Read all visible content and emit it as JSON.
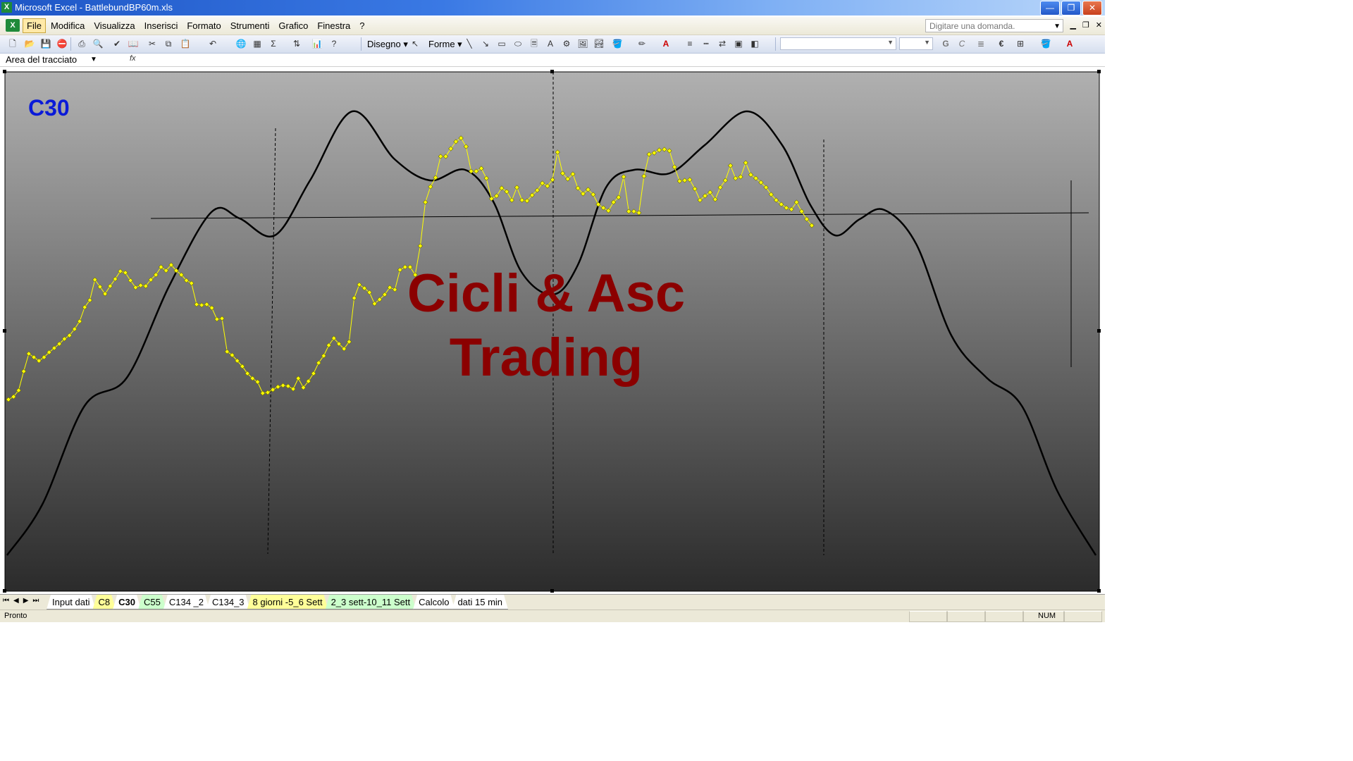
{
  "window": {
    "title": "Microsoft Excel - BattlebundBP60m.xls",
    "controls": [
      "—",
      "❐",
      "✕"
    ]
  },
  "menu": {
    "items": [
      "File",
      "Modifica",
      "Visualizza",
      "Inserisci",
      "Formato",
      "Strumenti",
      "Grafico",
      "Finestra",
      "?"
    ],
    "active": "File",
    "ask_placeholder": "Digitare una domanda."
  },
  "toolbar": {
    "draw_label": "Disegno",
    "shapes_label": "Forme",
    "bold_label": "G",
    "italic_label": "C",
    "euro_label": "€"
  },
  "namebox": {
    "value": "Area del tracciato",
    "fx": "fx"
  },
  "chart": {
    "label": "C30",
    "watermark_line1": "Cicli & Asc",
    "watermark_line2": "Trading",
    "colors": {
      "plot_top": "#b0b0b0",
      "plot_bottom": "#2b2b2b",
      "label": "#0a1ad8",
      "watermark": "#8b0000",
      "price_series": "#ffff00",
      "cycle_curve": "#000000"
    }
  },
  "chart_data": {
    "type": "line",
    "title": "C30",
    "series": [
      {
        "role": "price",
        "color": "#ffff00",
        "marker": "diamond",
        "values": [
          567,
          563,
          554,
          527,
          502,
          507,
          512,
          507,
          500,
          494,
          488,
          481,
          476,
          467,
          456,
          436,
          426,
          397,
          407,
          417,
          406,
          396,
          385,
          387,
          398,
          408,
          405,
          406,
          397,
          390,
          379,
          384,
          376,
          384,
          390,
          398,
          402,
          432,
          433,
          432,
          437,
          453,
          452,
          499,
          504,
          512,
          520,
          530,
          537,
          542,
          558,
          557,
          553,
          549,
          547,
          548,
          552,
          537,
          550,
          541,
          530,
          515,
          505,
          490,
          480,
          488,
          495,
          485,
          423,
          404,
          409,
          415,
          431,
          425,
          418,
          408,
          411,
          383,
          379,
          379,
          390,
          349,
          287,
          265,
          252,
          222,
          222,
          211,
          201,
          196,
          208,
          243,
          243,
          239,
          253,
          282,
          278,
          267,
          272,
          284,
          266,
          284,
          285,
          277,
          270,
          260,
          264,
          255,
          216,
          246,
          254,
          247,
          267,
          275,
          269,
          276,
          290,
          295,
          299,
          287,
          280,
          251,
          300,
          300,
          302,
          250,
          219,
          217,
          213,
          212,
          214,
          237,
          257,
          256,
          255,
          268,
          284,
          278,
          273,
          283,
          266,
          256,
          235,
          253,
          251,
          231,
          248,
          253,
          259,
          266,
          276,
          284,
          290,
          295,
          297,
          287,
          300,
          311,
          320
        ]
      },
      {
        "role": "cycle",
        "color": "#000000",
        "marker": "none"
      }
    ],
    "vertical_markers": [
      "dashed",
      "dashed",
      "dashed"
    ],
    "horizontal_reference": "solid"
  },
  "sheet_tabs": [
    {
      "label": "Input dati",
      "color": "#ffffff"
    },
    {
      "label": "C8",
      "color": "#ffff99"
    },
    {
      "label": "C30",
      "color": "#ffffff",
      "active": true
    },
    {
      "label": "C55",
      "color": "#ccffcc"
    },
    {
      "label": "C134 _2",
      "color": "#ffffff"
    },
    {
      "label": "C134_3",
      "color": "#ffffff"
    },
    {
      "label": "8 giorni -5_6 Sett",
      "color": "#ffff99"
    },
    {
      "label": "2_3 sett-10_11 Sett",
      "color": "#ccffcc"
    },
    {
      "label": "Calcolo",
      "color": "#ffffff"
    },
    {
      "label": "dati 15 min",
      "color": "#ffffff"
    }
  ],
  "tab_nav": [
    "⏮",
    "◀",
    "▶",
    "⏭"
  ],
  "status": {
    "left": "Pronto",
    "num": "NUM"
  }
}
